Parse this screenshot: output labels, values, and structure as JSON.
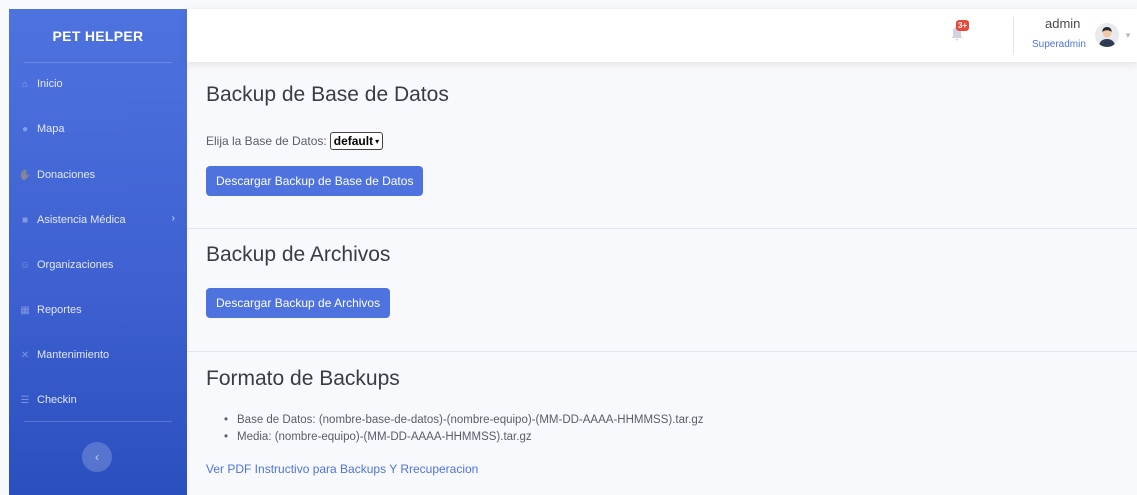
{
  "sidebar": {
    "brand": "PET HELPER",
    "items": [
      {
        "label": "Inicio",
        "icon": "home-icon"
      },
      {
        "label": "Mapa",
        "icon": "map-pin-icon"
      },
      {
        "label": "Donaciones",
        "icon": "hand-holding-icon"
      },
      {
        "label": "Asistencia Médica",
        "icon": "medical-kit-icon",
        "has_submenu": true
      },
      {
        "label": "Organizaciones",
        "icon": "users-icon"
      },
      {
        "label": "Reportes",
        "icon": "chart-icon"
      },
      {
        "label": "Mantenimiento",
        "icon": "tools-icon"
      },
      {
        "label": "Checkin",
        "icon": "list-icon"
      }
    ],
    "toggle_glyph": "‹"
  },
  "topbar": {
    "notification_badge": "3+",
    "user_name": "admin",
    "user_role": "Superadmin"
  },
  "main": {
    "db_section": {
      "title": "Backup de Base de Datos",
      "select_label": "Elija la Base de Datos:",
      "select_value": "default",
      "button": "Descargar Backup de Base de Datos"
    },
    "files_section": {
      "title": "Backup de Archivos",
      "button": "Descargar Backup de Archivos"
    },
    "format_section": {
      "title": "Formato de Backups",
      "items": [
        "Base de Datos: (nombre-base-de-datos)-(nombre-equipo)-(MM-DD-AAAA-HHMMSS).tar.gz",
        "Media: (nombre-equipo)-(MM-DD-AAAA-HHMMSS).tar.gz"
      ],
      "link": "Ver PDF Instructivo para Backups Y Rrecuperacion"
    }
  },
  "colors": {
    "primary": "#4e73df",
    "badge": "#e74a3b",
    "background": "#f8f9fc"
  }
}
